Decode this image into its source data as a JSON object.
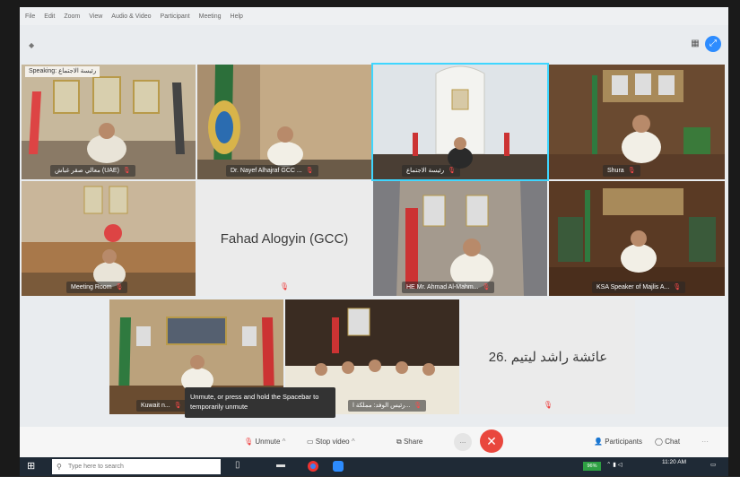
{
  "menu": [
    "File",
    "Edit",
    "Zoom",
    "View",
    "Audio & Video",
    "Participant",
    "Meeting",
    "Help"
  ],
  "speaking_label": "Speaking: رئيسة الاجتماع",
  "tiles": [
    {
      "label": "معالي صقر غباش (UAE)"
    },
    {
      "label": "Dr. Nayef Alhajraf GCC ..."
    },
    {
      "label": "رئيسة الاجتماع"
    },
    {
      "label": "Shura"
    },
    {
      "label": "Meeting Room"
    },
    {
      "label": "HE Mr. Ahmad Al-Mahm..."
    },
    {
      "label": "KSA Speaker of Majlis A..."
    },
    {
      "label": "Kuwait n..."
    },
    {
      "label": "رئيس الوفد: مملكة ا..."
    }
  ],
  "text_tiles": [
    {
      "name": "Fahad Alogyin (GCC)"
    },
    {
      "name": "26. عائشة راشد ليتيم"
    }
  ],
  "tooltip": "Unmute, or press and hold the Spacebar to temporarily unmute",
  "controls": {
    "unmute": "Unmute",
    "stop_video": "Stop video",
    "share": "Share",
    "more": "...",
    "participants": "Participants",
    "chat": "Chat",
    "end": "✕"
  },
  "taskbar": {
    "search_placeholder": "Type here to search",
    "battery": "96%",
    "time": "11:20 AM"
  },
  "colors": {
    "accent": "#2d8cff",
    "end": "#e9473d",
    "muted_mic": "#ff4a4a"
  }
}
